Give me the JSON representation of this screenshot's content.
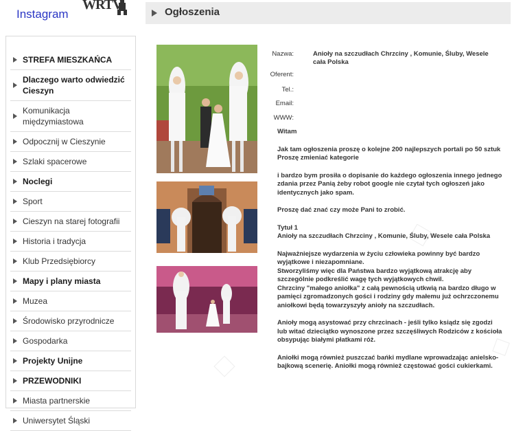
{
  "top": {
    "instagram_label": "Instagram",
    "brand": "WRTV",
    "brand_icon": "tower-icon"
  },
  "sidebar": {
    "items": [
      {
        "label": "STREFA MIESZKAŃCA",
        "bold": true
      },
      {
        "label": "Dlaczego warto odwiedzić Cieszyn",
        "bold": true
      },
      {
        "label": "Komunikacja międzymiastowa",
        "bold": false
      },
      {
        "label": "Odpocznij w Cieszynie",
        "bold": false
      },
      {
        "label": "Szlaki spacerowe",
        "bold": false
      },
      {
        "label": "Noclegi",
        "bold": true
      },
      {
        "label": "Sport",
        "bold": false
      },
      {
        "label": "Cieszyn na starej fotografii",
        "bold": false
      },
      {
        "label": "Historia i tradycja",
        "bold": false
      },
      {
        "label": "Klub Przedsiębiorcy",
        "bold": false
      },
      {
        "label": "Mapy i plany miasta",
        "bold": true
      },
      {
        "label": "Muzea",
        "bold": false
      },
      {
        "label": "Środowisko przyrodnicze",
        "bold": false
      },
      {
        "label": "Gospodarka",
        "bold": false
      },
      {
        "label": "Projekty Unijne",
        "bold": true
      },
      {
        "label": "PRZEWODNIKI",
        "bold": true
      },
      {
        "label": "Miasta partnerskie",
        "bold": false
      },
      {
        "label": "Uniwersytet Śląski",
        "bold": false
      }
    ]
  },
  "header": {
    "title": "Ogłoszenia"
  },
  "listing": {
    "name_label": "Nazwa:",
    "name_value": "Anioły na szczudłach Chrzciny , Komunie, Śluby, Wesele cała Polska",
    "author_label": "Oferent:",
    "author_value": "",
    "phone_label": "Tel.:",
    "phone_value": "",
    "email_label": "Email:",
    "email_value": "",
    "www_label": "WWW:",
    "www_value": ""
  },
  "body": {
    "p1": "Witam",
    "p2": "Jak tam ogłoszenia proszę o kolejne 200 najlepszych portali po 50 sztuk",
    "p2b": "Proszę zmieniać kategorie",
    "p3": "i bardzo bym prosiła o dopisanie do każdego ogłoszenia innego jednego zdania przez Panią żeby robot google nie czytał tych ogłoszeń jako identycznych jako spam.",
    "p4": "Proszę dać znać czy może Pani to zrobić.",
    "p5a": "Tytuł 1",
    "p5b": "Anioły na szczudłach Chrzciny , Komunie, Śluby, Wesele cała Polska",
    "p6a": "Najważniejsze wydarzenia w życiu człowieka powinny być bardzo wyjątkowe i niezapomniane.",
    "p6b": "Stworzyliśmy więc dla Państwa bardzo wyjątkową atrakcję aby szczególnie podkreślić wagę tych wyjątkowych chwil.",
    "p6c": "Chrzciny \"małego aniołka\" z całą pewnością utkwią na bardzo długo w pamięci zgromadzonych gości i rodziny gdy małemu już ochrzczonemu aniołkowi będą towarzyszyły anioły na szczudłach.",
    "p7": "Anioły mogą asystować przy chrzcinach - jeśli tylko ksiądz się zgodzi lub witać dzieciątko wynoszone przez szczęśliwych Rodziców z kościoła obsypując białymi płatkami róż.",
    "p8": "Aniołki mogą również puszczać bańki mydlane wprowadzając anielsko- bajkową scenerię. Aniołki mogą również częstować gości cukierkami."
  },
  "colors": {
    "instagram_link": "#2a36c4",
    "header_bg": "#ececec"
  }
}
